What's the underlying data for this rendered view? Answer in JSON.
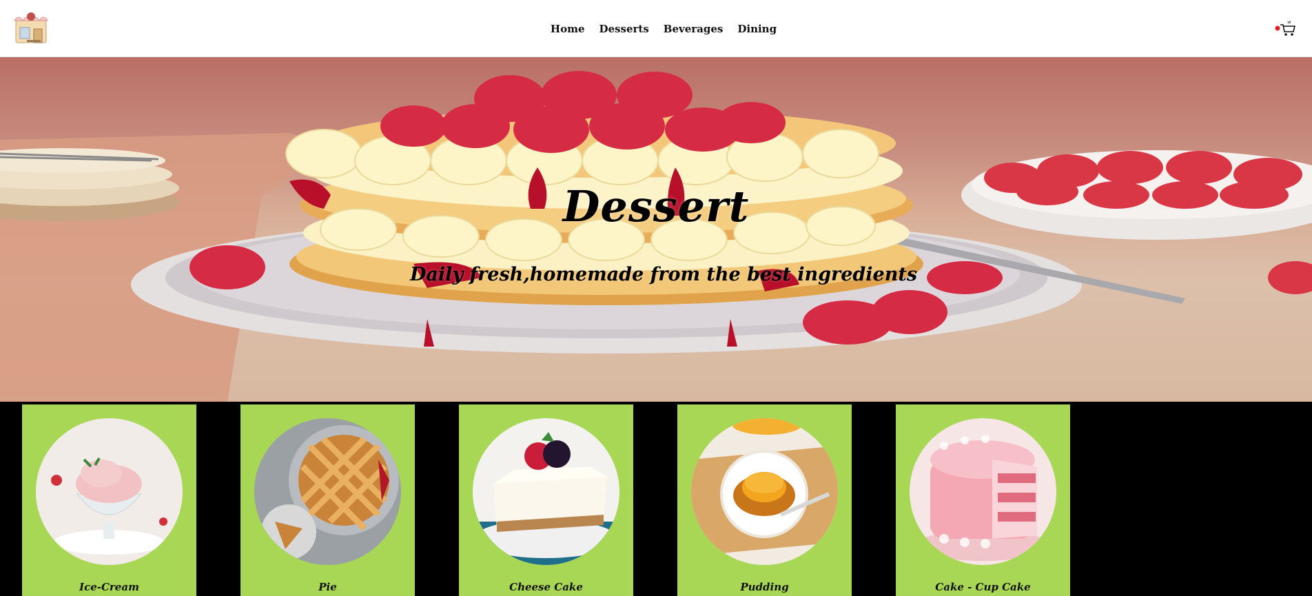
{
  "header": {
    "logo_icon": "shop-storefront-icon",
    "nav": [
      "Home",
      "Desserts",
      "Beverages",
      "Dining"
    ],
    "cart_icon": "shopping-cart-icon",
    "cart_badge_color": "#e02020"
  },
  "hero": {
    "title": "Dessert",
    "subtitle": "Daily fresh,homemade from the best ingredients"
  },
  "categories": [
    {
      "label": "Ice-Cream",
      "icon": "ice-cream-image"
    },
    {
      "label": "Pie",
      "icon": "pie-image"
    },
    {
      "label": "Cheese Cake",
      "icon": "cheese-cake-image"
    },
    {
      "label": "Pudding",
      "icon": "pudding-image"
    },
    {
      "label": "Cake - Cup Cake",
      "icon": "cake-image"
    }
  ],
  "colors": {
    "card_bg": "#a8d655",
    "page_bg": "#000000",
    "header_bg": "#ffffff"
  }
}
